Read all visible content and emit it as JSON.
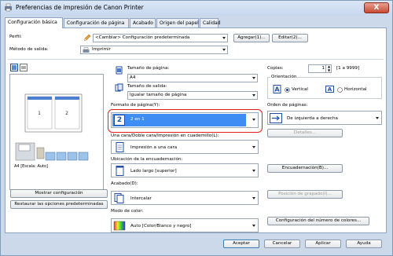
{
  "window": {
    "title": "Preferencias de impresión de Canon Printer",
    "close_label": "X"
  },
  "tabs": [
    "Configuración básica",
    "Configuración de página",
    "Acabado",
    "Origen del papel",
    "Calidad"
  ],
  "profile": {
    "label": "Perfil:",
    "value": "<Cambiar> Configuración predeterminada",
    "add_label": "Agregar(1)...",
    "edit_label": "Editar(2)..."
  },
  "output_method": {
    "label": "Método de salida:",
    "value": "Imprimir"
  },
  "preview": {
    "caption": "A4 [Escala: Auto]",
    "show_settings_label": "Mostrar configuración",
    "restore_defaults_label": "Restaurar las opciones predeterminadas"
  },
  "page_size": {
    "label": "Tamaño de página:",
    "value": "A4"
  },
  "output_size": {
    "label": "Tamaño de salida:",
    "value": "Igualar tamaño de página"
  },
  "copies": {
    "label": "Copias:",
    "value": "1",
    "range": "[1 a 9999]"
  },
  "orientation": {
    "label": "Orientación",
    "vertical": "Vertical",
    "horizontal": "Horizontal",
    "selected": "Vertical"
  },
  "page_layout": {
    "label": "Formato de página(Y):",
    "value": "2 en 1",
    "icon_number": "2"
  },
  "page_order": {
    "label": "Orden de páginas:",
    "value": "De izquierda a derecha",
    "details_label": "Detalles..."
  },
  "one_two_sided": {
    "label": "Una cara/Doble cara/Impresión en cuadernillo(L):",
    "value": "Impresión a una cara"
  },
  "binding_location": {
    "label": "Ubicación de la encuadernación:",
    "value": "Lado largo [superior]",
    "binding_button": "Encuadernación(B)..."
  },
  "finishing": {
    "label": "Acabado(D):",
    "value": "Intercalar",
    "staple_button": "Posición de grapado(I)..."
  },
  "color_mode": {
    "label": "Modo de color:",
    "value": "Auto [Color/Blanco y negro]",
    "color_count_button": "Configuración del número de colores..."
  },
  "footer": {
    "ok": "Aceptar",
    "cancel": "Cancelar",
    "apply": "Aplicar",
    "help": "Ayuda"
  },
  "colors": {
    "accent": "#3d8df5",
    "highlight_border": "#e0201c",
    "panel_bg": "#ffffff",
    "frame_bg": "#cbd9eb"
  }
}
